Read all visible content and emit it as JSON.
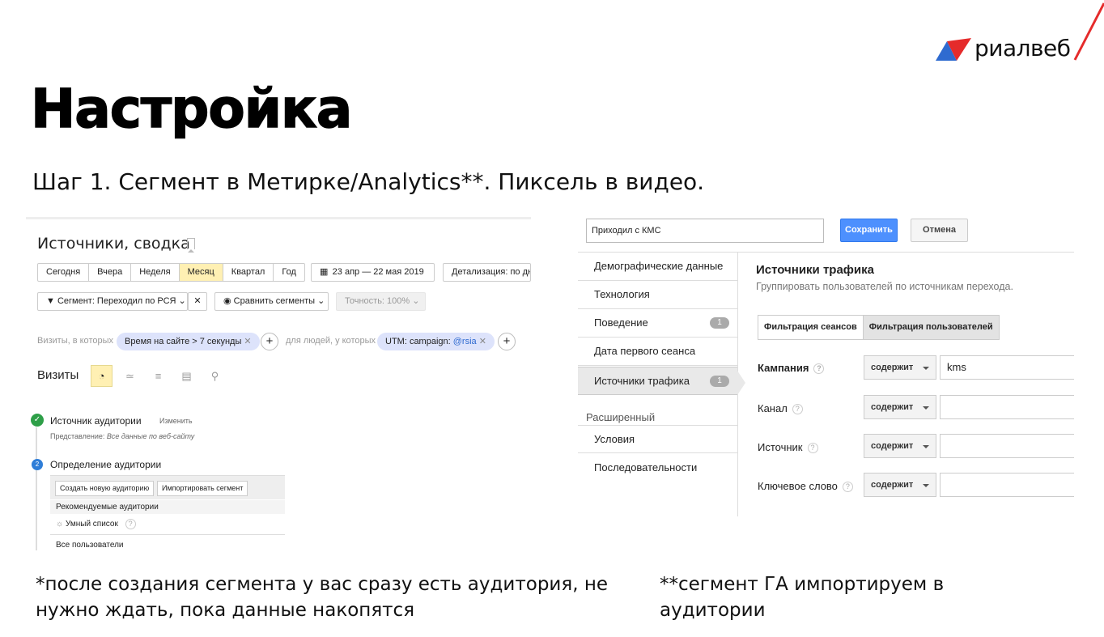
{
  "brand": {
    "name": "риалвеб",
    "colors": {
      "red": "#e52b2b",
      "blue": "#2f6bd0"
    }
  },
  "slide": {
    "title": "Настройка",
    "subtitle": "Шаг 1. Сегмент в Метирке/Analytics**. Пиксель в видео."
  },
  "metrica": {
    "report_title": "Источники, сводка",
    "periods": [
      "Сегодня",
      "Вчера",
      "Неделя",
      "Месяц",
      "Квартал",
      "Год"
    ],
    "active_period": "Месяц",
    "date_range": "23 апр — 22 мая 2019",
    "detail": "Детализация: по дн",
    "segment": "Сегмент: Переходил по РСЯ",
    "compare": "Сравнить сегменты",
    "accuracy": "Точность: 100%",
    "visits_where": "Визиты, в которых",
    "visit_condition": "Время на сайте > 7 секунды",
    "people_where": "для людей, у которых",
    "people_condition_prefix": "UTM: campaign: ",
    "people_condition_value": "@rsia",
    "visits_label": "Визиты"
  },
  "audience": {
    "source_title": "Источник аудитории",
    "source_edit": "Изменить",
    "view_label": "Представление:",
    "view_value": "Все данные по веб-сайту",
    "step2_number": "2",
    "step2_title": "Определение аудитории",
    "create_btn": "Создать новую аудиторию",
    "import_btn": "Импортировать сегмент",
    "recommended": "Рекомендуемые аудитории",
    "smart_list": "Умный список",
    "all_users": "Все пользователи"
  },
  "ga": {
    "segment_name": "Приходил с КМС",
    "save": "Сохранить",
    "cancel": "Отмена",
    "nav": [
      {
        "label": "Демографические данные",
        "count": ""
      },
      {
        "label": "Технология",
        "count": ""
      },
      {
        "label": "Поведение",
        "count": "1"
      },
      {
        "label": "Дата первого сеанса",
        "count": ""
      },
      {
        "label": "Источники трафика",
        "count": "1"
      }
    ],
    "advanced": "Расширенный",
    "nav_advanced": [
      "Условия",
      "Последовательности"
    ],
    "heading": "Источники трафика",
    "subheading": "Группировать пользователей по источникам перехода.",
    "tab_sessions": "Фильтрация сеансов",
    "tab_users": "Фильтрация пользователей",
    "rows": [
      {
        "label": "Кампания",
        "op": "содержит",
        "value": "kms"
      },
      {
        "label": "Канал",
        "op": "содержит",
        "value": ""
      },
      {
        "label": "Источник",
        "op": "содержит",
        "value": ""
      },
      {
        "label": "Ключевое слово",
        "op": "содержит",
        "value": ""
      }
    ],
    "help": "?"
  },
  "notes": {
    "left": "*после создания сегмента у вас сразу есть аудитория, не нужно ждать, пока данные накопятся",
    "right": "**сегмент ГА импортируем в аудитории"
  }
}
